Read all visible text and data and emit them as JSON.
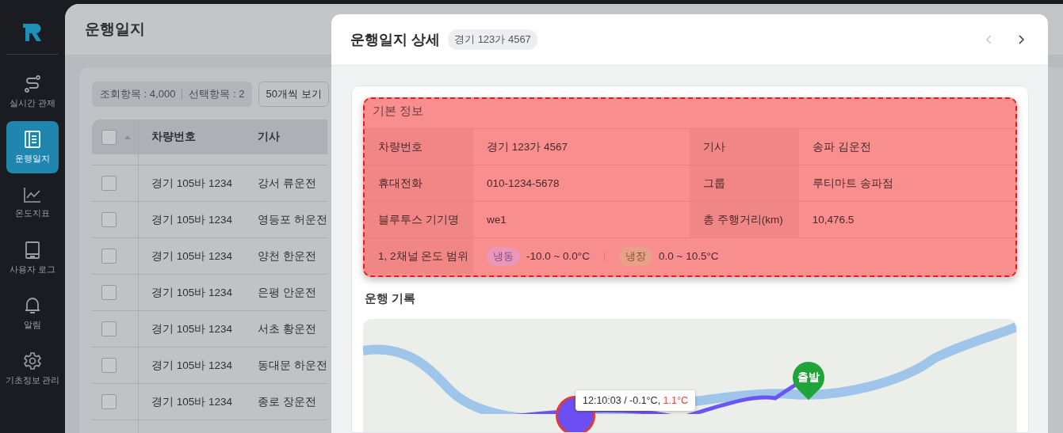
{
  "sidebar": {
    "items": [
      {
        "kind": "route",
        "label": "실시간 관제",
        "selected": false
      },
      {
        "kind": "logbook",
        "label": "운행일지",
        "selected": true
      },
      {
        "kind": "chart",
        "label": "온도지표",
        "selected": false
      },
      {
        "kind": "tablet",
        "label": "사용자 로그",
        "selected": false
      },
      {
        "kind": "bell",
        "label": "알림",
        "selected": false
      },
      {
        "kind": "gear",
        "label": "기초정보 관리",
        "selected": false
      }
    ]
  },
  "list": {
    "title": "운행일지",
    "total": "조회항목 : 4,000",
    "selected_count": "선택항목 : 2",
    "page_size": "50개씩 보기",
    "select_all_checked": false,
    "columns": [
      "차량번호",
      "기사"
    ],
    "rows": [
      {
        "vehicle": "경기 105바 1234",
        "driver": "강서 류운전",
        "checked": false
      },
      {
        "vehicle": "경기 105바 1234",
        "driver": "영등포 허운전",
        "checked": false
      },
      {
        "vehicle": "경기 105바 1234",
        "driver": "양천 한운전",
        "checked": false
      },
      {
        "vehicle": "경기 105바 1234",
        "driver": "은평 안운전",
        "checked": false
      },
      {
        "vehicle": "경기 105바 1234",
        "driver": "서초 황운전",
        "checked": false
      },
      {
        "vehicle": "경기 105바 1234",
        "driver": "동대문 하운전",
        "checked": false
      },
      {
        "vehicle": "경기 105바 1234",
        "driver": "종로 장운전",
        "checked": false
      }
    ]
  },
  "detail": {
    "title": "운행일지 상세",
    "badge": "경기 123가 4567",
    "nav_buttons": [
      {
        "kind": "prev",
        "disabled": true
      },
      {
        "kind": "next",
        "disabled": false
      }
    ],
    "info": {
      "title": "기본 정보",
      "highlighted": true,
      "rows": [
        {
          "cells": [
            {
              "label": "차량번호",
              "value": "경기 123가 4567"
            },
            {
              "label": "기사",
              "value": "송파 김운전"
            }
          ]
        },
        {
          "cells": [
            {
              "label": "휴대전화",
              "value": "010-1234-5678"
            },
            {
              "label": "그룹",
              "value": "루티마트 송파점"
            }
          ]
        },
        {
          "cells": [
            {
              "label": "블루투스 기기명",
              "value": "we1"
            },
            {
              "label": "총 주행거리(km)",
              "value": "10,476.5"
            }
          ]
        }
      ],
      "range": {
        "label": "1, 2채널 온도 범위",
        "ranges": [
          {
            "kind": "frozen",
            "tag": "냉동",
            "value": "-10.0 ~ 0.0°C"
          },
          {
            "kind": "chilled",
            "tag": "냉장",
            "value": "0.0 ~ 10.5°C"
          }
        ]
      }
    },
    "record": {
      "title": "운행 기록",
      "start_label": "출발",
      "tooltip": {
        "text": "12:10:03 / -0.1°C,",
        "alert": "1.1°C"
      }
    }
  }
}
